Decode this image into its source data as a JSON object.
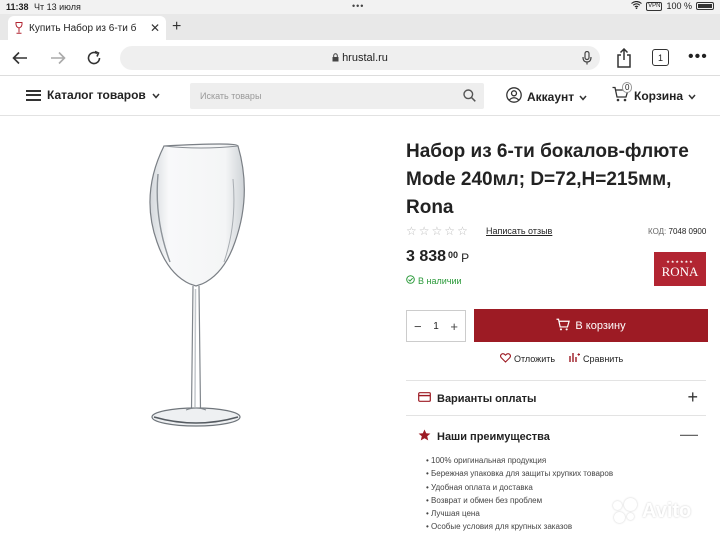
{
  "status_bar": {
    "time": "11:38",
    "date": "Чт 13 июля",
    "dots": "•••",
    "vpn": "VPN",
    "battery": "100 %"
  },
  "browser": {
    "tab_title": "Купить Набор из 6-ти б",
    "tab_close": "✕",
    "new_tab": "+",
    "url": "hrustal.ru",
    "tab_count": "1",
    "more": "•••"
  },
  "header": {
    "catalog_label": "Каталог товаров",
    "search_placeholder": "Искать товары",
    "account_label": "Аккаунт",
    "cart_label": "Корзина",
    "cart_count": "0"
  },
  "product": {
    "title": "Набор из 6-ти бокалов-флюте Mode 240мл; D=72,H=215мм, Rona",
    "rating_stars": [
      "☆",
      "☆",
      "☆",
      "☆",
      "☆"
    ],
    "review_link": "Написать отзыв",
    "sku_label": "КОД:",
    "sku_value": "7048 0900",
    "price_main": "3 838",
    "price_cents": "00",
    "currency": "Р",
    "brand": "RONA",
    "stock": "В наличии",
    "quantity": "1",
    "qty_minus": "−",
    "qty_plus": "+",
    "add_to_cart": "В корзину",
    "wishlist": "Отложить",
    "compare": "Сравнить"
  },
  "accordions": [
    {
      "label": "Варианты оплаты",
      "toggle": "+"
    },
    {
      "label": "Наши преимущества",
      "toggle": "—"
    }
  ],
  "benefits": [
    "• 100% оригинальная продукция",
    "• Бережная упаковка для защиты хрупких товаров",
    "• Удобная оплата и доставка",
    "• Возврат и обмен без проблем",
    "• Лучшая цена",
    "• Особые условия для крупных заказов"
  ],
  "watermark": "Avito",
  "colors": {
    "accent": "#9d1b24",
    "in_stock": "#2b9a3a",
    "brand_logo": "#b22532"
  }
}
